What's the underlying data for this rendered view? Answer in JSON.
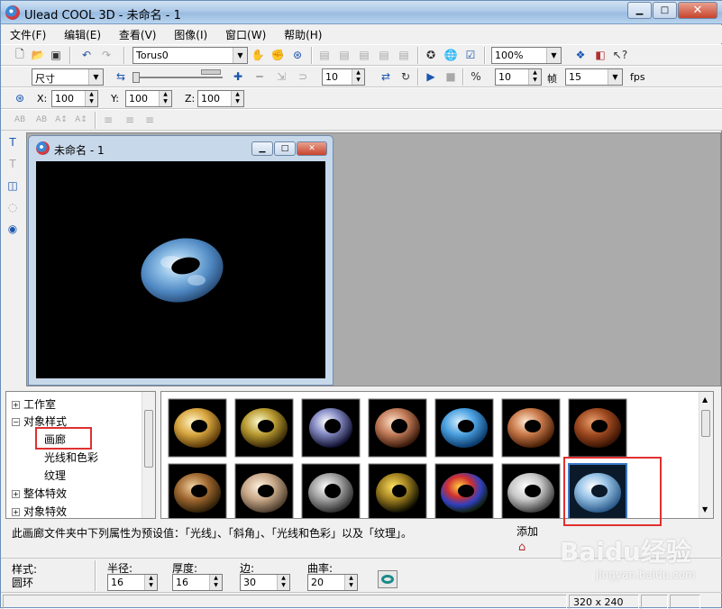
{
  "window": {
    "title": "Ulead COOL 3D - 未命名 - 1"
  },
  "menu": [
    "文件(F)",
    "编辑(E)",
    "查看(V)",
    "图像(I)",
    "窗口(W)",
    "帮助(H)"
  ],
  "toolbar1": {
    "object_combo": "Torus0",
    "zoom_combo": "100%"
  },
  "toolbar2": {
    "size_combo": "尺寸",
    "spin_a": "10",
    "spin_b": "10",
    "frame_label": "帧",
    "fps_value": "15",
    "fps_label": "fps"
  },
  "toolbar3": {
    "x_label": "X:",
    "x_value": "100",
    "y_label": "Y:",
    "y_value": "100",
    "z_label": "Z:",
    "z_value": "100"
  },
  "document": {
    "title": "未命名 - 1"
  },
  "tree": [
    {
      "label": "工作室",
      "expander": "+"
    },
    {
      "label": "对象样式",
      "expander": "−"
    },
    {
      "label": "画廊",
      "expander": ""
    },
    {
      "label": "光线和色彩",
      "expander": ""
    },
    {
      "label": "纹理",
      "expander": ""
    },
    {
      "label": "整体特效",
      "expander": "+"
    },
    {
      "label": "对象特效",
      "expander": "+"
    }
  ],
  "description": "此画廊文件夹中下列属性为预设值：「光线」、「斜角」、「光线和色彩」以及「纹理」。",
  "add_label": "添加",
  "params": {
    "style_label": "样式:",
    "style_value": "圆环",
    "radius_label": "半径:",
    "radius_value": "16",
    "thickness_label": "厚度:",
    "thickness_value": "16",
    "edge_label": "边:",
    "edge_value": "30",
    "curvature_label": "曲率:",
    "curvature_value": "20"
  },
  "status": {
    "size": "320 x 240"
  },
  "watermark": {
    "brand": "Baidu经验",
    "url": "jingyan.baidu.com"
  }
}
